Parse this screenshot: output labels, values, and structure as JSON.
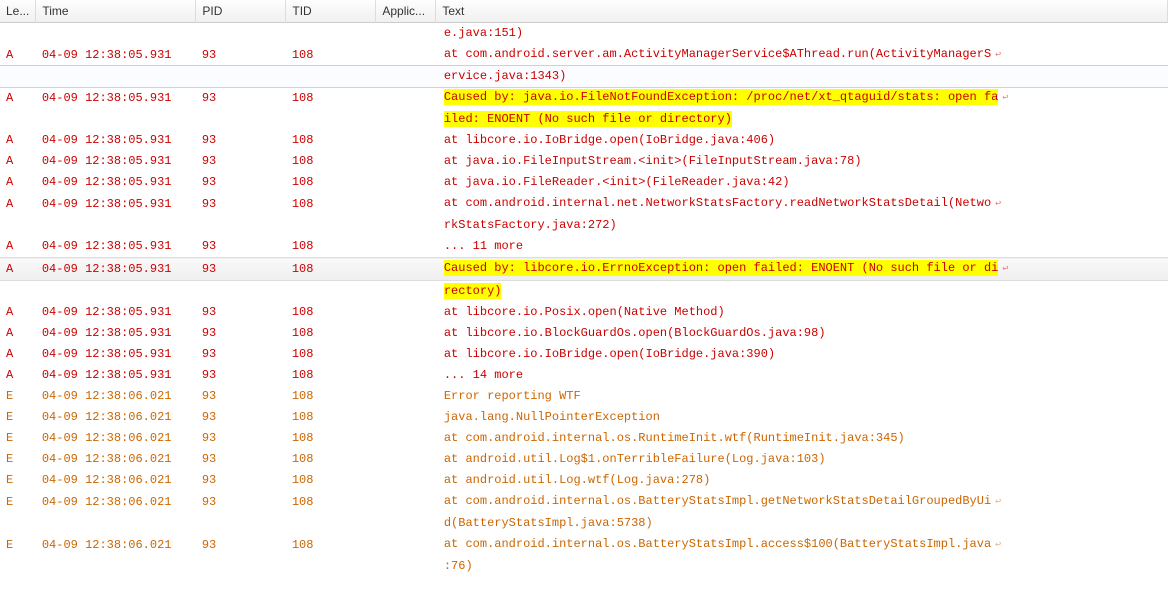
{
  "headers": {
    "level": "Le...",
    "time": "Time",
    "pid": "PID",
    "tid": "TID",
    "app": "Applic...",
    "text": "Text"
  },
  "wrap_symbol": "↩",
  "rows": [
    {
      "level": "",
      "time": "",
      "pid": "",
      "tid": "",
      "app": "",
      "text": "e.java:151)",
      "color": "red",
      "highlight": false
    },
    {
      "level": "A",
      "time": "04-09 12:38:05.931",
      "pid": "93",
      "tid": "108",
      "app": "",
      "text": "at com.android.server.am.ActivityManagerService$AThread.run(ActivityManagerS",
      "color": "red",
      "highlight": false,
      "wrap": true
    },
    {
      "level": "",
      "time": "",
      "pid": "",
      "tid": "",
      "app": "",
      "text": "ervice.java:1343)",
      "color": "red",
      "highlight": false,
      "outlined": true
    },
    {
      "level": "A",
      "time": "04-09 12:38:05.931",
      "pid": "93",
      "tid": "108",
      "app": "",
      "text": "Caused by: java.io.FileNotFoundException: /proc/net/xt_qtaguid/stats: open fa",
      "color": "red",
      "highlight": true,
      "wrap": true
    },
    {
      "level": "",
      "time": "",
      "pid": "",
      "tid": "",
      "app": "",
      "text": "iled: ENOENT (No such file or directory)",
      "color": "red",
      "highlight": true
    },
    {
      "level": "A",
      "time": "04-09 12:38:05.931",
      "pid": "93",
      "tid": "108",
      "app": "",
      "text": "at libcore.io.IoBridge.open(IoBridge.java:406)",
      "color": "red",
      "highlight": false
    },
    {
      "level": "A",
      "time": "04-09 12:38:05.931",
      "pid": "93",
      "tid": "108",
      "app": "",
      "text": "at java.io.FileInputStream.<init>(FileInputStream.java:78)",
      "color": "red",
      "highlight": false
    },
    {
      "level": "A",
      "time": "04-09 12:38:05.931",
      "pid": "93",
      "tid": "108",
      "app": "",
      "text": "at java.io.FileReader.<init>(FileReader.java:42)",
      "color": "red",
      "highlight": false
    },
    {
      "level": "A",
      "time": "04-09 12:38:05.931",
      "pid": "93",
      "tid": "108",
      "app": "",
      "text": "at com.android.internal.net.NetworkStatsFactory.readNetworkStatsDetail(Netwo",
      "color": "red",
      "highlight": false,
      "wrap": true
    },
    {
      "level": "",
      "time": "",
      "pid": "",
      "tid": "",
      "app": "",
      "text": "rkStatsFactory.java:272)",
      "color": "red",
      "highlight": false
    },
    {
      "level": "A",
      "time": "04-09 12:38:05.931",
      "pid": "93",
      "tid": "108",
      "app": "",
      "text": "... 11 more",
      "color": "red",
      "highlight": false
    },
    {
      "level": "A",
      "time": "04-09 12:38:05.931",
      "pid": "93",
      "tid": "108",
      "app": "",
      "text": "Caused by: libcore.io.ErrnoException: open failed: ENOENT (No such file or di",
      "color": "red",
      "highlight": true,
      "selected": true,
      "wrap": true
    },
    {
      "level": "",
      "time": "",
      "pid": "",
      "tid": "",
      "app": "",
      "text": "rectory)",
      "color": "red",
      "highlight": true
    },
    {
      "level": "A",
      "time": "04-09 12:38:05.931",
      "pid": "93",
      "tid": "108",
      "app": "",
      "text": "at libcore.io.Posix.open(Native Method)",
      "color": "red",
      "highlight": false
    },
    {
      "level": "A",
      "time": "04-09 12:38:05.931",
      "pid": "93",
      "tid": "108",
      "app": "",
      "text": "at libcore.io.BlockGuardOs.open(BlockGuardOs.java:98)",
      "color": "red",
      "highlight": false
    },
    {
      "level": "A",
      "time": "04-09 12:38:05.931",
      "pid": "93",
      "tid": "108",
      "app": "",
      "text": "at libcore.io.IoBridge.open(IoBridge.java:390)",
      "color": "red",
      "highlight": false
    },
    {
      "level": "A",
      "time": "04-09 12:38:05.931",
      "pid": "93",
      "tid": "108",
      "app": "",
      "text": "... 14 more",
      "color": "red",
      "highlight": false
    },
    {
      "level": "E",
      "time": "04-09 12:38:06.021",
      "pid": "93",
      "tid": "108",
      "app": "",
      "text": "Error reporting WTF",
      "color": "orange",
      "highlight": false
    },
    {
      "level": "E",
      "time": "04-09 12:38:06.021",
      "pid": "93",
      "tid": "108",
      "app": "",
      "text": "java.lang.NullPointerException",
      "color": "orange",
      "highlight": false
    },
    {
      "level": "E",
      "time": "04-09 12:38:06.021",
      "pid": "93",
      "tid": "108",
      "app": "",
      "text": "at com.android.internal.os.RuntimeInit.wtf(RuntimeInit.java:345)",
      "color": "orange",
      "highlight": false
    },
    {
      "level": "E",
      "time": "04-09 12:38:06.021",
      "pid": "93",
      "tid": "108",
      "app": "",
      "text": "at android.util.Log$1.onTerribleFailure(Log.java:103)",
      "color": "orange",
      "highlight": false
    },
    {
      "level": "E",
      "time": "04-09 12:38:06.021",
      "pid": "93",
      "tid": "108",
      "app": "",
      "text": "at android.util.Log.wtf(Log.java:278)",
      "color": "orange",
      "highlight": false
    },
    {
      "level": "E",
      "time": "04-09 12:38:06.021",
      "pid": "93",
      "tid": "108",
      "app": "",
      "text": "at com.android.internal.os.BatteryStatsImpl.getNetworkStatsDetailGroupedByUi",
      "color": "orange",
      "highlight": false,
      "wrap": true
    },
    {
      "level": "",
      "time": "",
      "pid": "",
      "tid": "",
      "app": "",
      "text": "d(BatteryStatsImpl.java:5738)",
      "color": "orange",
      "highlight": false
    },
    {
      "level": "E",
      "time": "04-09 12:38:06.021",
      "pid": "93",
      "tid": "108",
      "app": "",
      "text": "at com.android.internal.os.BatteryStatsImpl.access$100(BatteryStatsImpl.java",
      "color": "orange",
      "highlight": false,
      "wrap": true
    },
    {
      "level": "",
      "time": "",
      "pid": "",
      "tid": "",
      "app": "",
      "text": ":76)",
      "color": "orange",
      "highlight": false
    }
  ]
}
